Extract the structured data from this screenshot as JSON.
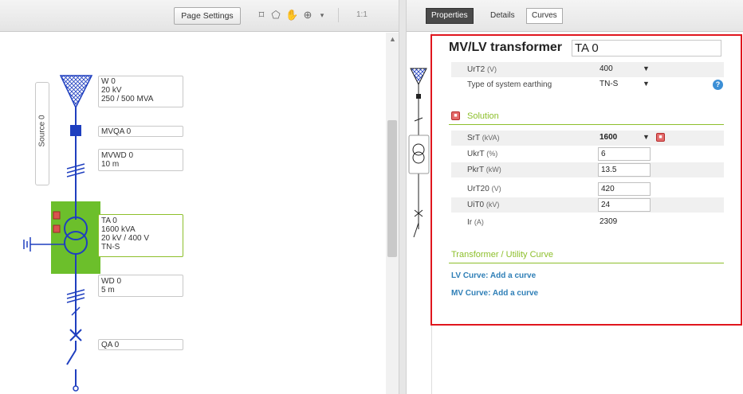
{
  "toolbar": {
    "page_settings_label": "Page Settings",
    "zoom_label": "1:1",
    "icons": [
      "selection-icon",
      "lasso-icon",
      "pan-hand-icon",
      "zoom-icon",
      "zoom-dropdown-icon"
    ]
  },
  "canvas": {
    "source_tab_label": "Source 0",
    "components": [
      {
        "id": "W0",
        "lines": [
          "W 0",
          "20 kV",
          "250 / 500 MVA"
        ]
      },
      {
        "id": "MVQA0",
        "lines": [
          "MVQA 0"
        ]
      },
      {
        "id": "MVWD0",
        "lines": [
          "MVWD 0",
          "10 m"
        ]
      },
      {
        "id": "TA0",
        "lines": [
          "TA 0",
          "1600 kVA",
          "20 kV / 400 V",
          "TN-S"
        ]
      },
      {
        "id": "WD0",
        "lines": [
          "WD 0",
          "5 m"
        ]
      },
      {
        "id": "QA0",
        "lines": [
          "QA 0"
        ]
      }
    ],
    "selected_color": "#6cbf2b",
    "line_color": "#1f3fbf"
  },
  "tabs": [
    {
      "label": "Properties",
      "active": true
    },
    {
      "label": "Details",
      "active": false
    },
    {
      "label": "Curves",
      "active": false
    }
  ],
  "properties": {
    "title": "MV/LV transformer",
    "name_value": "TA 0",
    "general_rows": [
      {
        "key": "UrT2",
        "unit": "(V)",
        "value": "400",
        "type": "dropdown"
      },
      {
        "key": "Type of system earthing",
        "unit": "",
        "value": "TN-S",
        "type": "dropdown",
        "help": true
      }
    ],
    "solution_title": "Solution",
    "solution_rows": [
      {
        "key": "SrT",
        "unit": "(kVA)",
        "value": "1600",
        "type": "dropdown",
        "locked": true
      },
      {
        "key": "UkrT",
        "unit": "(%)",
        "value": "6",
        "type": "input"
      },
      {
        "key": "PkrT",
        "unit": "(kW)",
        "value": "13.5",
        "type": "input"
      },
      {
        "key": "UrT20",
        "unit": "(V)",
        "value": "420",
        "type": "input"
      },
      {
        "key": "UiT0",
        "unit": "(kV)",
        "value": "24",
        "type": "input"
      },
      {
        "key": "Ir",
        "unit": "(A)",
        "value": "2309",
        "type": "text"
      }
    ],
    "curve_title": "Transformer / Utility Curve",
    "lv_curve_link": "LV Curve: Add a curve",
    "mv_curve_link": "MV Curve: Add a curve",
    "accent_color": "#8dbf2b",
    "highlight_border_color": "#e0161e",
    "help_icon": "help-icon",
    "lock_icon": "lock-icon"
  }
}
